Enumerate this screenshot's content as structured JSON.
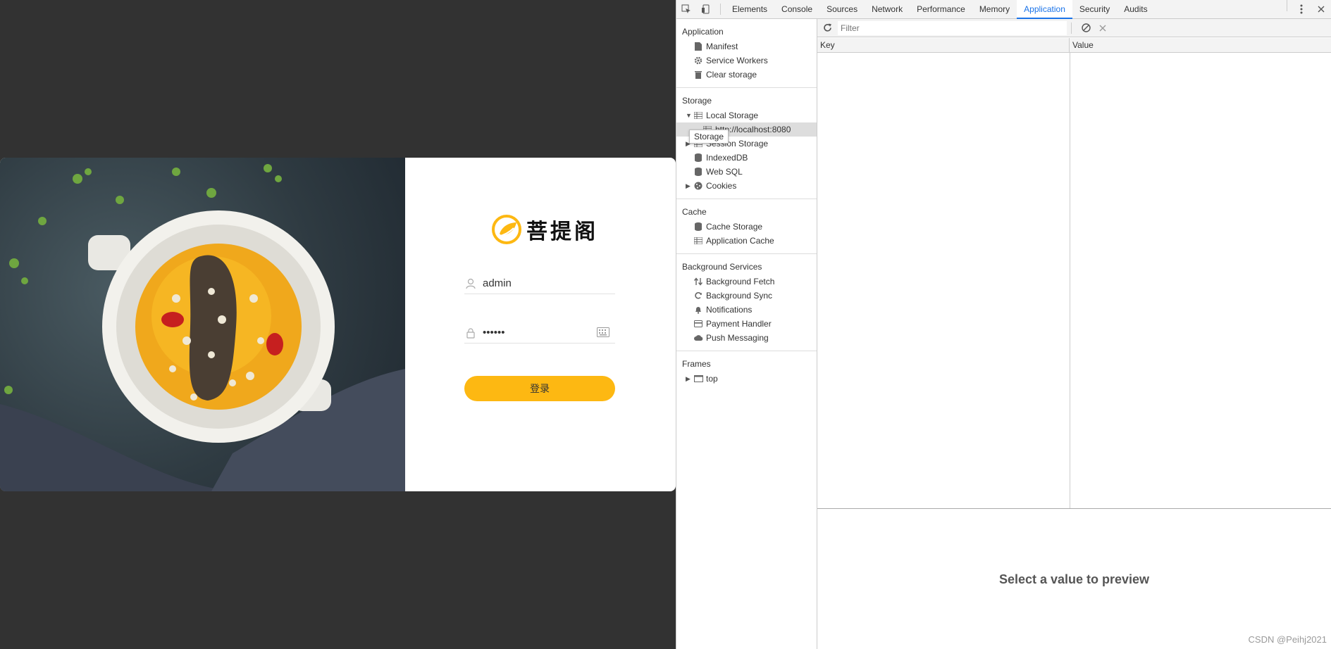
{
  "login": {
    "brand_name": "菩提阁",
    "username_value": "admin",
    "password_value": "••••••",
    "login_button": "登录"
  },
  "devtools": {
    "tabs": [
      "Elements",
      "Console",
      "Sources",
      "Network",
      "Performance",
      "Memory",
      "Application",
      "Security",
      "Audits"
    ],
    "active_tab": "Application",
    "sidebar": {
      "application_title": "Application",
      "application_items": [
        "Manifest",
        "Service Workers",
        "Clear storage"
      ],
      "storage_title": "Storage",
      "local_storage": "Local Storage",
      "local_storage_origin": "http://localhost:8080",
      "storage_items": [
        "Session Storage",
        "IndexedDB",
        "Web SQL",
        "Cookies"
      ],
      "cache_title": "Cache",
      "cache_items": [
        "Cache Storage",
        "Application Cache"
      ],
      "bg_title": "Background Services",
      "bg_items": [
        "Background Fetch",
        "Background Sync",
        "Notifications",
        "Payment Handler",
        "Push Messaging"
      ],
      "frames_title": "Frames",
      "frames_items": [
        "top"
      ],
      "tooltip": "Storage"
    },
    "filter_placeholder": "Filter",
    "table": {
      "key_header": "Key",
      "value_header": "Value"
    },
    "preview_text": "Select a value to preview"
  },
  "watermark": "CSDN @Peihj2021",
  "colors": {
    "accent": "#fdb812",
    "devtools_active": "#1a73e8"
  }
}
